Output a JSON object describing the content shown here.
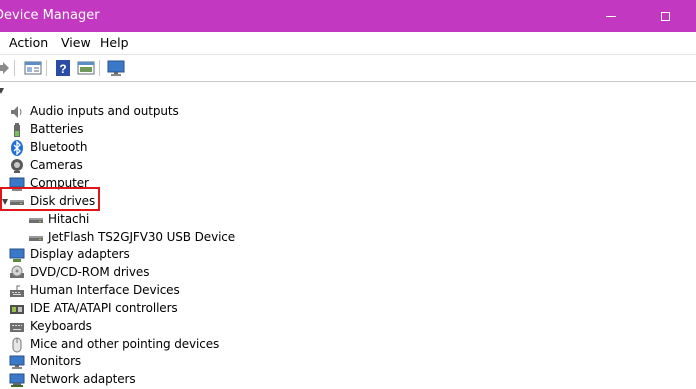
{
  "window": {
    "title": "Device Manager",
    "titlebar_color": "#c238c0"
  },
  "menu": [
    "Action",
    "View",
    "Help"
  ],
  "toolbar": {
    "icons": [
      "forward-arrow-icon",
      "properties-icon",
      "help-icon",
      "update-driver-icon",
      "monitor-icon"
    ]
  },
  "tree": {
    "categories": [
      {
        "label": "Audio inputs and outputs",
        "icon": "speaker-icon"
      },
      {
        "label": "Batteries",
        "icon": "battery-icon"
      },
      {
        "label": "Bluetooth",
        "icon": "bluetooth-icon"
      },
      {
        "label": "Cameras",
        "icon": "camera-icon"
      },
      {
        "label": "Computer",
        "icon": "computer-icon"
      },
      {
        "label": "Disk drives",
        "icon": "disk-drive-icon",
        "expanded": true,
        "children": [
          {
            "label": "Hitachi",
            "icon": "disk-drive-icon"
          },
          {
            "label": "JetFlash TS2GJFV30 USB Device",
            "icon": "disk-drive-icon"
          }
        ]
      },
      {
        "label": "Display adapters",
        "icon": "display-adapter-icon"
      },
      {
        "label": "DVD/CD-ROM drives",
        "icon": "dvd-drive-icon"
      },
      {
        "label": "Human Interface Devices",
        "icon": "hid-icon"
      },
      {
        "label": "IDE ATA/ATAPI controllers",
        "icon": "ide-controller-icon"
      },
      {
        "label": "Keyboards",
        "icon": "keyboard-icon"
      },
      {
        "label": "Mice and other pointing devices",
        "icon": "mouse-icon"
      },
      {
        "label": "Monitors",
        "icon": "monitor-icon"
      },
      {
        "label": "Network adapters",
        "icon": "network-adapter-icon"
      }
    ]
  },
  "annotation": {
    "highlight_color": "#e0161a",
    "highlighted_item": "Disk drives"
  }
}
